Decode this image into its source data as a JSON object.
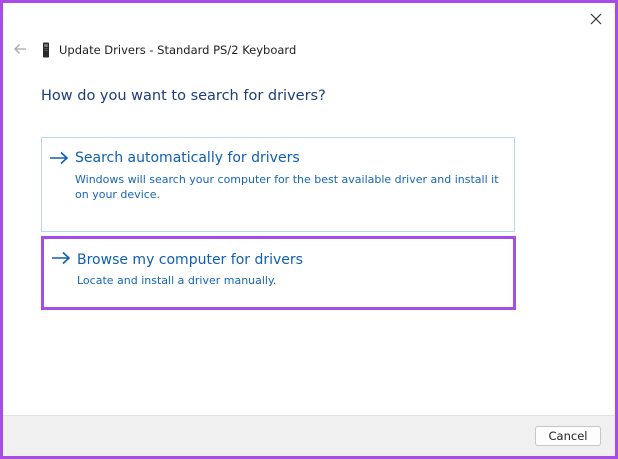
{
  "window": {
    "title": "Update Drivers - Standard PS/2 Keyboard",
    "close_icon": "close-icon",
    "back_icon": "back-arrow-icon",
    "device_icon": "keyboard-device-icon"
  },
  "main": {
    "question": "How do you want to search for drivers?",
    "options": [
      {
        "title": "Search automatically for drivers",
        "description": "Windows will search your computer for the best available driver and install it on your device.",
        "icon": "arrow-right-icon"
      },
      {
        "title": "Browse my computer for drivers",
        "description": "Locate and install a driver manually.",
        "icon": "arrow-right-icon"
      }
    ]
  },
  "footer": {
    "cancel_label": "Cancel"
  },
  "colors": {
    "highlight": "#a64de6",
    "link": "#0f5fb0",
    "heading": "#1c3d7a"
  }
}
